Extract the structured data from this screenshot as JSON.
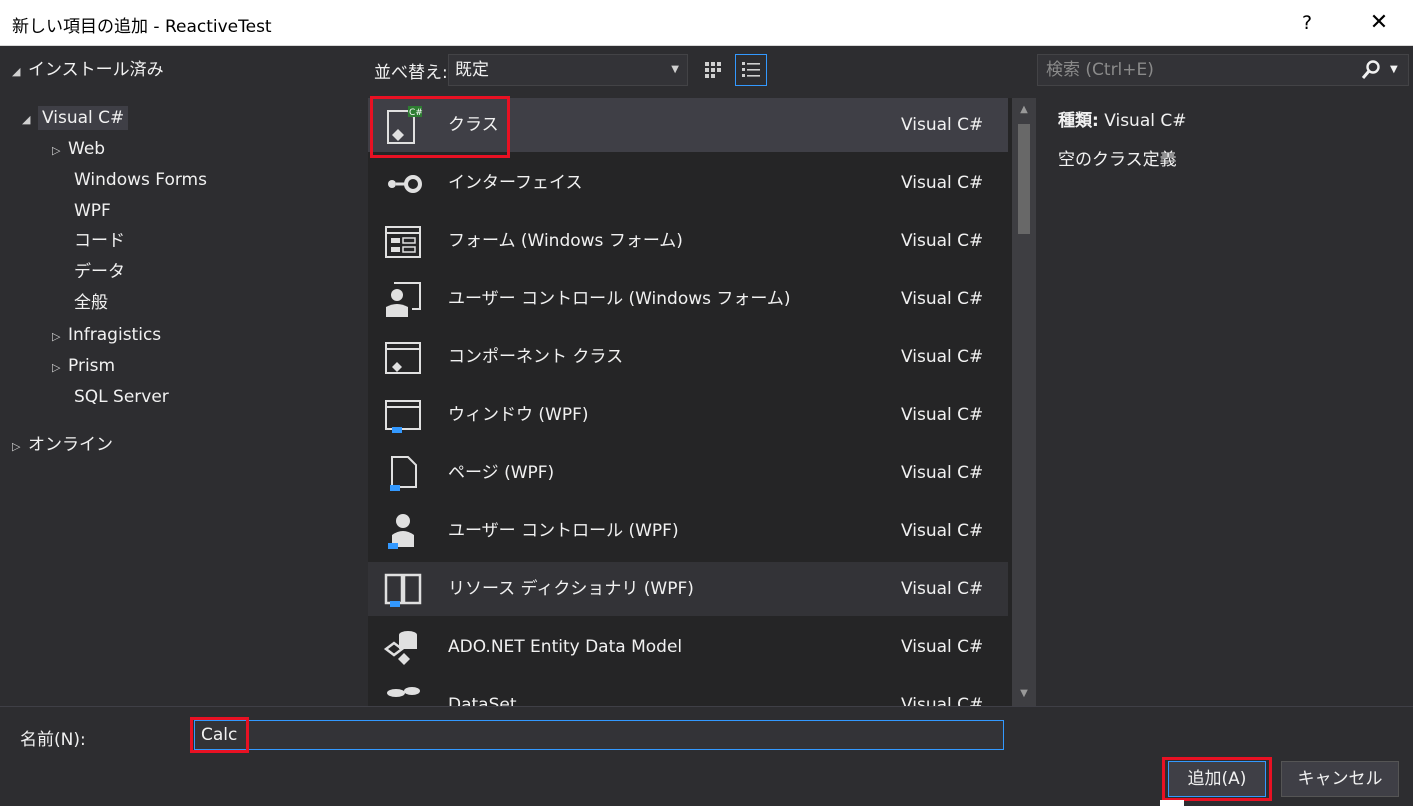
{
  "window": {
    "title": "新しい項目の追加 - ReactiveTest",
    "help_glyph": "?",
    "close_glyph": "✕"
  },
  "tree": {
    "installed": "インストール済み",
    "visual_csharp": "Visual C#",
    "children": [
      "Web",
      "Windows Forms",
      "WPF",
      "コード",
      "データ",
      "全般",
      "Infragistics",
      "Prism",
      "SQL Server"
    ],
    "online": "オンライン"
  },
  "toolbar": {
    "sort_label": "並べ替え:",
    "sort_value": "既定",
    "search_placeholder": "検索 (Ctrl+E)"
  },
  "items": [
    {
      "name": "クラス",
      "lang": "Visual C#",
      "icon": "class-icon"
    },
    {
      "name": "インターフェイス",
      "lang": "Visual C#",
      "icon": "interface-icon"
    },
    {
      "name": "フォーム (Windows フォーム)",
      "lang": "Visual C#",
      "icon": "form-icon"
    },
    {
      "name": "ユーザー コントロール (Windows フォーム)",
      "lang": "Visual C#",
      "icon": "user-control-icon"
    },
    {
      "name": "コンポーネント クラス",
      "lang": "Visual C#",
      "icon": "component-class-icon"
    },
    {
      "name": "ウィンドウ (WPF)",
      "lang": "Visual C#",
      "icon": "wpf-window-icon"
    },
    {
      "name": "ページ (WPF)",
      "lang": "Visual C#",
      "icon": "wpf-page-icon"
    },
    {
      "name": "ユーザー コントロール (WPF)",
      "lang": "Visual C#",
      "icon": "wpf-user-control-icon"
    },
    {
      "name": "リソース ディクショナリ (WPF)",
      "lang": "Visual C#",
      "icon": "resource-dictionary-icon"
    },
    {
      "name": "ADO.NET Entity Data Model",
      "lang": "Visual C#",
      "icon": "entity-data-model-icon"
    },
    {
      "name": "DataSet",
      "lang": "Visual C#",
      "icon": "dataset-icon"
    }
  ],
  "details": {
    "kind_label": "種類:",
    "kind_value": "Visual C#",
    "description": "空のクラス定義"
  },
  "footer": {
    "name_label": "名前(N):",
    "name_value": "Calc",
    "add_button": "追加(A)",
    "cancel_button": "キャンセル"
  },
  "colors": {
    "accent": "#3399ff",
    "highlight_red": "#e81123",
    "background": "#2d2d30",
    "list_background": "#252526"
  }
}
